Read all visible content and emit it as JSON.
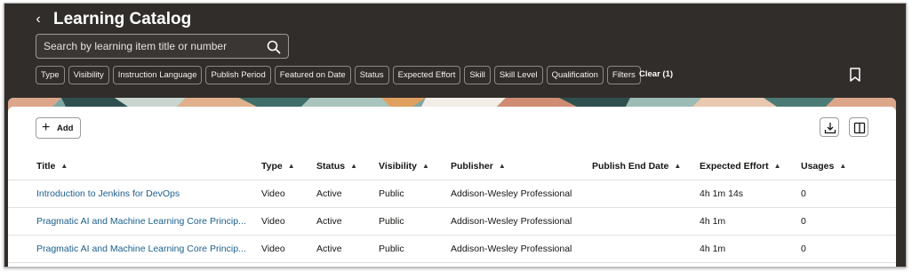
{
  "header": {
    "title": "Learning Catalog",
    "search_placeholder": "Search by learning item title or number",
    "filters": [
      "Type",
      "Visibility",
      "Instruction Language",
      "Publish Period",
      "Featured on Date",
      "Status",
      "Expected Effort",
      "Skill",
      "Skill Level",
      "Qualification",
      "Filters"
    ],
    "clear_label": "Clear (1)"
  },
  "toolbar": {
    "add_label": "Add"
  },
  "table": {
    "columns": [
      "Title",
      "Type",
      "Status",
      "Visibility",
      "Publisher",
      "Publish End Date",
      "Expected Effort",
      "Usages"
    ],
    "rows": [
      [
        "Introduction to Jenkins for DevOps",
        "Video",
        "Active",
        "Public",
        "Addison-Wesley Professional",
        "",
        "4h 1m 14s",
        "0"
      ],
      [
        "Pragmatic AI and Machine Learning Core Princip...",
        "Video",
        "Active",
        "Public",
        "Addison-Wesley Professional",
        "",
        "4h 1m",
        "0"
      ],
      [
        "Pragmatic AI and Machine Learning Core Princip...",
        "Video",
        "Active",
        "Public",
        "Addison-Wesley Professional",
        "",
        "4h 1m",
        "0"
      ]
    ]
  },
  "colors": {
    "header_bg": "#312d2a",
    "link": "#1b5f8c"
  }
}
